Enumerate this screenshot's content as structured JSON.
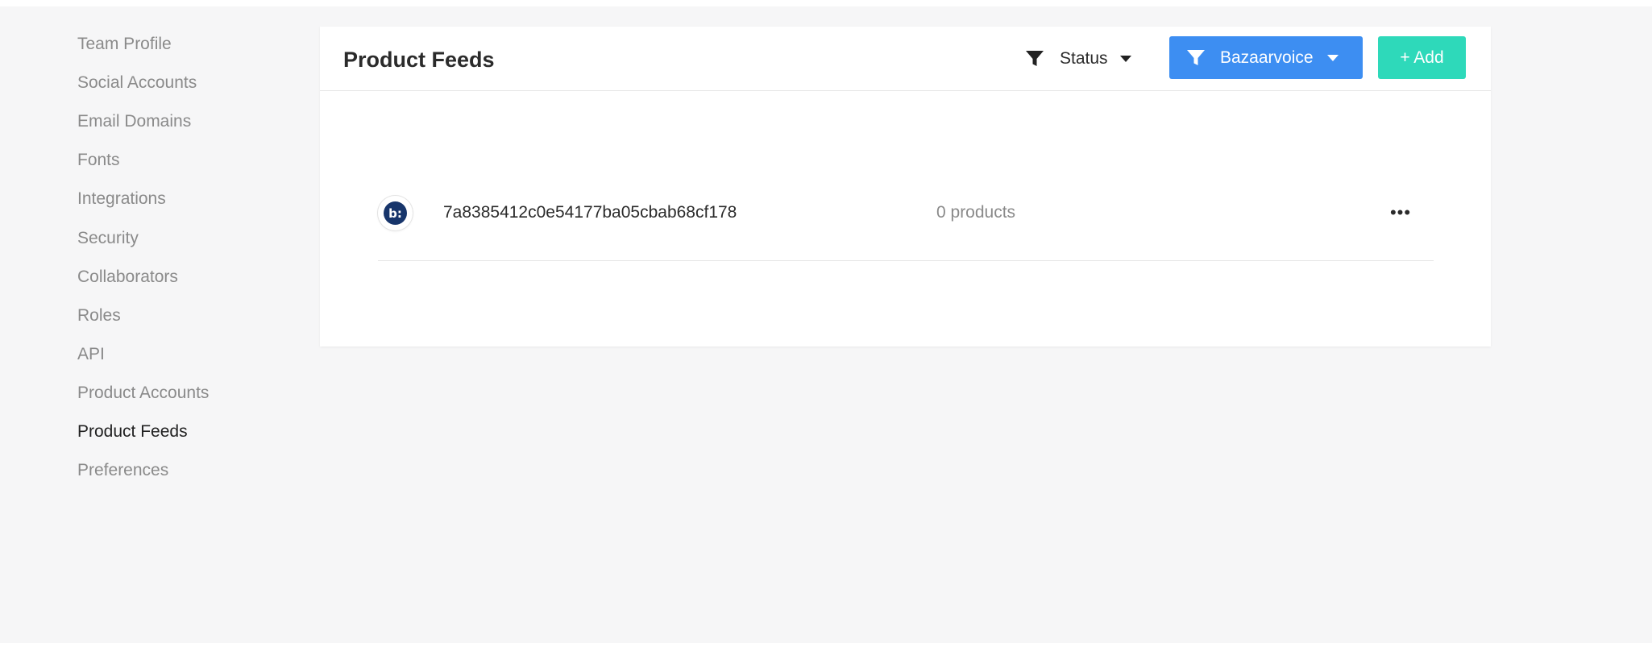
{
  "sidebar": {
    "items": [
      {
        "label": "Team Profile",
        "active": false
      },
      {
        "label": "Social Accounts",
        "active": false
      },
      {
        "label": "Email Domains",
        "active": false
      },
      {
        "label": "Fonts",
        "active": false
      },
      {
        "label": "Integrations",
        "active": false
      },
      {
        "label": "Security",
        "active": false
      },
      {
        "label": "Collaborators",
        "active": false
      },
      {
        "label": "Roles",
        "active": false
      },
      {
        "label": "API",
        "active": false
      },
      {
        "label": "Product Accounts",
        "active": false
      },
      {
        "label": "Product Feeds",
        "active": true
      },
      {
        "label": "Preferences",
        "active": false
      }
    ]
  },
  "header": {
    "title": "Product Feeds",
    "status_filter_label": "Status",
    "source_filter_label": "Bazaarvoice",
    "add_label": "+ Add"
  },
  "feeds": [
    {
      "logo_text": "b:",
      "name": "7a8385412c0e54177ba05cbab68cf178",
      "count": "0 products",
      "menu": "•••"
    }
  ],
  "colors": {
    "source_button": "#3d8ef2",
    "add_button": "#2ed9ba",
    "logo": "#17356b",
    "background": "#f6f6f7"
  }
}
